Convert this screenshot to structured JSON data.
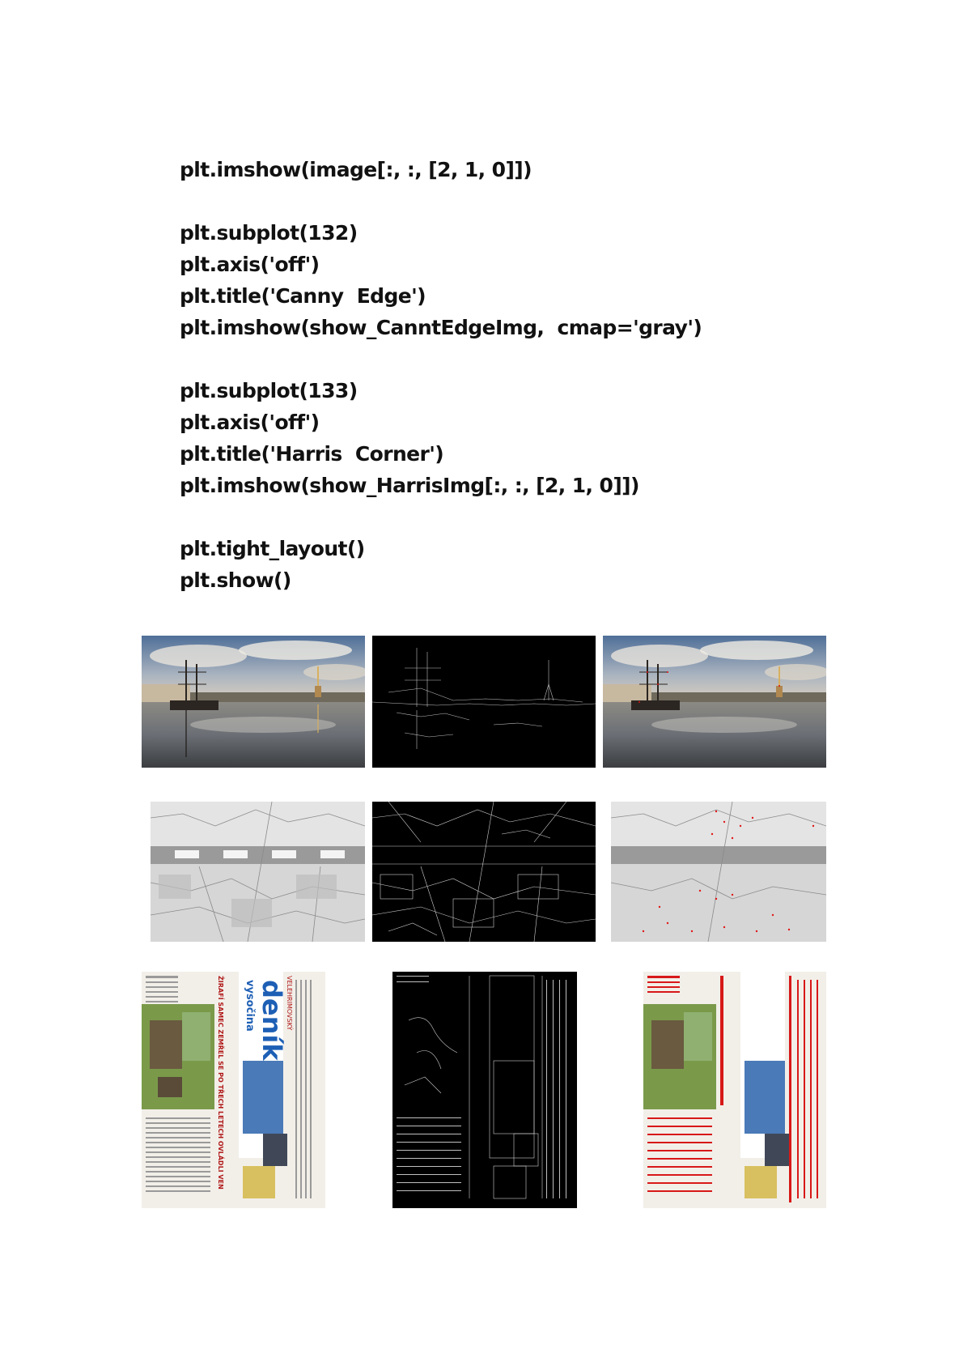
{
  "code_lines": [
    "plt.imshow(image[:, :, [2, 1, 0]])",
    "",
    "plt.subplot(132)",
    "plt.axis('off')",
    "plt.title('Canny  Edge')",
    "plt.imshow(show_CanntEdgeImg,  cmap='gray')",
    "",
    "plt.subplot(133)",
    "plt.axis('off')",
    "plt.title('Harris  Corner')",
    "plt.imshow(show_HarrisImg[:, :, [2, 1, 0]])",
    "",
    "plt.tight_layout()",
    "plt.show()"
  ],
  "figures": [
    {
      "name": "harbor",
      "panels": [
        "original",
        "canny-edge",
        "harris-corner"
      ]
    },
    {
      "name": "aerial-map",
      "panels": [
        "original",
        "canny-edge",
        "harris-corner"
      ]
    },
    {
      "name": "newspaper",
      "panels": [
        "original",
        "canny-edge",
        "harris-corner"
      ],
      "newspaper_text": {
        "masthead": "deník",
        "region": "vysočina",
        "headline": "ŽIRAFÍ SAMEC ZEMŘEL SE PO TŘECH LETECH OVLÁDLI VEN",
        "top_line": "VELEHRIMOVSKÝ"
      }
    }
  ]
}
